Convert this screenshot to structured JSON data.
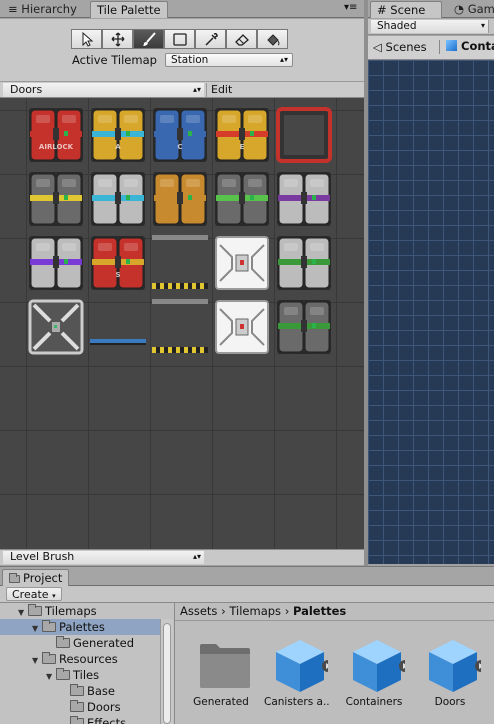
{
  "tabs_left": {
    "hierarchy": "Hierarchy",
    "tile_palette": "Tile Palette",
    "menu_icon": "≡"
  },
  "tabs_right": {
    "scene": "Scene",
    "game": "Game"
  },
  "scene": {
    "shading": "Shaded",
    "scenes_label": "Scenes",
    "context": "Conta"
  },
  "palette": {
    "tools": [
      "select",
      "move",
      "paint",
      "box-fill",
      "picker",
      "erase",
      "flood-fill"
    ],
    "selected_tool": "paint",
    "active_tilemap_label": "Active Tilemap",
    "active_tilemap_value": "Station",
    "palette_value": "Doors",
    "edit_label": "Edit",
    "brush_value": "Level Brush"
  },
  "project": {
    "tab": "Project",
    "create_label": "Create",
    "tree": [
      {
        "label": "Tilemaps",
        "depth": 1,
        "expanded": true
      },
      {
        "label": "Palettes",
        "depth": 2,
        "expanded": true,
        "selected": true
      },
      {
        "label": "Generated",
        "depth": 3,
        "expanded": false
      },
      {
        "label": "Resources",
        "depth": 2,
        "expanded": true
      },
      {
        "label": "Tiles",
        "depth": 3,
        "expanded": true
      },
      {
        "label": "Base",
        "depth": 4,
        "expanded": false
      },
      {
        "label": "Doors",
        "depth": 4,
        "expanded": false
      },
      {
        "label": "Effects",
        "depth": 4,
        "expanded": false
      }
    ],
    "breadcrumb": {
      "part1": "Assets",
      "part2": "Tilemaps",
      "part3": "Palettes",
      "sep": "›"
    },
    "assets": [
      {
        "label": "Generated",
        "kind": "folder"
      },
      {
        "label": "Canisters a...",
        "kind": "prefab"
      },
      {
        "label": "Containers",
        "kind": "prefab"
      },
      {
        "label": "Doors",
        "kind": "prefab"
      }
    ]
  },
  "tiles": [
    {
      "kind": "door",
      "body": "#c4322b",
      "stripe": "#c4322b",
      "label": "AIRLOCK",
      "col": 0,
      "row": 0
    },
    {
      "kind": "door",
      "body": "#d6a72a",
      "stripe": "#3ab5d6",
      "label": "A",
      "col": 1,
      "row": 0
    },
    {
      "kind": "door",
      "body": "#3a68b0",
      "stripe": "#3a68b0",
      "label": "C",
      "col": 2,
      "row": 0
    },
    {
      "kind": "door",
      "body": "#d6a72a",
      "stripe": "#d63c2a",
      "label": "E",
      "col": 3,
      "row": 0
    },
    {
      "kind": "frame",
      "body": "#c4322b",
      "stripe": "#d6a72a",
      "label": "",
      "col": 4,
      "row": 0
    },
    {
      "kind": "door",
      "body": "#6a6a6a",
      "stripe": "#e0c630",
      "label": "",
      "col": 0,
      "row": 1
    },
    {
      "kind": "door",
      "body": "#bcbcbc",
      "stripe": "#3ab5d6",
      "label": "",
      "col": 1,
      "row": 1
    },
    {
      "kind": "door",
      "body": "#c88a2e",
      "stripe": "#c88a2e",
      "label": "",
      "col": 2,
      "row": 1
    },
    {
      "kind": "door",
      "body": "#6a6a6a",
      "stripe": "#58c24a",
      "label": "",
      "col": 3,
      "row": 1
    },
    {
      "kind": "door",
      "body": "#bcbcbc",
      "stripe": "#7a3aa0",
      "label": "",
      "col": 4,
      "row": 1
    },
    {
      "kind": "door",
      "body": "#bcbcbc",
      "stripe": "#7a3ad6",
      "label": "",
      "col": 0,
      "row": 2
    },
    {
      "kind": "door",
      "body": "#c4322b",
      "stripe": "#d6a72a",
      "label": "S",
      "col": 1,
      "row": 2
    },
    {
      "kind": "hazard",
      "body": "#444",
      "stripe": "#e0c630",
      "label": "",
      "col": 2,
      "row": 2
    },
    {
      "kind": "white",
      "body": "#e8e8e8",
      "stripe": "#999",
      "label": "",
      "col": 3,
      "row": 2
    },
    {
      "kind": "door",
      "body": "#bcbcbc",
      "stripe": "#3a9a3a",
      "label": "",
      "col": 4,
      "row": 2
    },
    {
      "kind": "open",
      "body": "#bcbcbc",
      "stripe": "#3ab56a",
      "label": "",
      "col": 0,
      "row": 3
    },
    {
      "kind": "rail",
      "body": "#555",
      "stripe": "#3a7ac0",
      "label": "",
      "col": 1,
      "row": 3
    },
    {
      "kind": "hazard",
      "body": "#444",
      "stripe": "#e0c630",
      "label": "",
      "col": 2,
      "row": 3
    },
    {
      "kind": "white",
      "body": "#e8e8e8",
      "stripe": "#999",
      "label": "",
      "col": 3,
      "row": 3
    },
    {
      "kind": "door",
      "body": "#6a6a6a",
      "stripe": "#3a9a3a",
      "label": "",
      "col": 4,
      "row": 3
    }
  ]
}
